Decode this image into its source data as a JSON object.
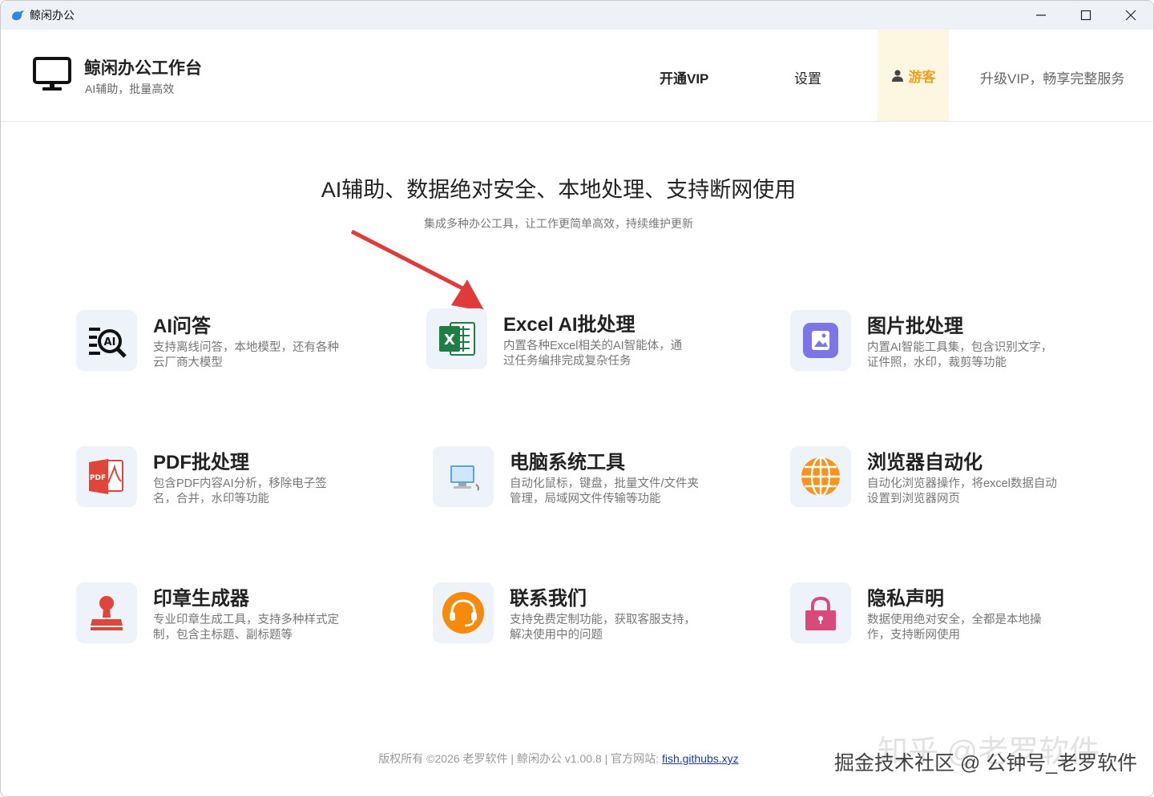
{
  "window": {
    "title": "鲸闲办公"
  },
  "header": {
    "brand_title": "鲸闲办公工作台",
    "brand_subtitle": "AI辅助，批量高效",
    "nav": {
      "vip": "开通VIP",
      "settings": "设置",
      "guest": "游客",
      "upgrade": "升级VIP，畅享完整服务"
    }
  },
  "hero": {
    "title": "AI辅助、数据绝对安全、本地处理、支持断网使用",
    "subtitle": "集成多种办公工具，让工作更简单高效，持续维护更新"
  },
  "cards": [
    {
      "title": "AI问答",
      "desc": "支持离线问答，本地模型，还有各种云厂商大模型",
      "icon": "ai-search-icon"
    },
    {
      "title": "Excel AI批处理",
      "desc": "内置各种Excel相关的AI智能体，通过任务编排完成复杂任务",
      "icon": "excel-icon"
    },
    {
      "title": "图片批处理",
      "desc": "内置AI智能工具集，包含识别文字，证件照，水印，裁剪等功能",
      "icon": "image-icon"
    },
    {
      "title": "PDF批处理",
      "desc": "包含PDF内容AI分析，移除电子签名，合并，水印等功能",
      "icon": "pdf-icon"
    },
    {
      "title": "电脑系统工具",
      "desc": "自动化鼠标，键盘，批量文件/文件夹管理，局域网文件传输等功能",
      "icon": "computer-icon"
    },
    {
      "title": "浏览器自动化",
      "desc": "自动化浏览器操作，将excel数据自动设置到浏览器网页",
      "icon": "globe-icon"
    },
    {
      "title": "印章生成器",
      "desc": "专业印章生成工具，支持多种样式定制，包含主标题、副标题等",
      "icon": "stamp-icon"
    },
    {
      "title": "联系我们",
      "desc": "支持免费定制功能，获取客服支持，解决使用中的问题",
      "icon": "headset-icon"
    },
    {
      "title": "隐私声明",
      "desc": "数据使用绝对安全，全都是本地操作，支持断网使用",
      "icon": "lock-icon"
    }
  ],
  "footer": {
    "text": "版权所有 ©2026 老罗软件 | 鲸闲办公 v1.00.8 | 官方网站: ",
    "link": "fish.githubs.xyz"
  },
  "watermark": {
    "line1": "知乎 @老罗软件",
    "line2": "掘金技术社区 @ 公钟号_老罗软件"
  }
}
